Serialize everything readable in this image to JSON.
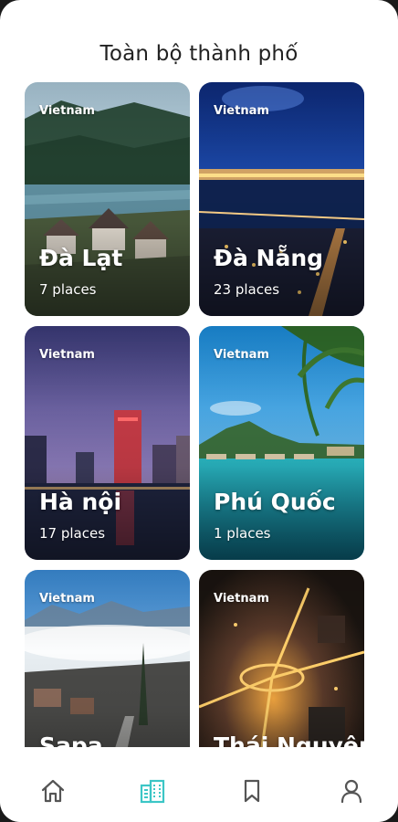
{
  "header": {
    "title": "Toàn bộ thành phố"
  },
  "cities": [
    {
      "country": "Vietnam",
      "name": "Đà Lạt",
      "places": "7 places",
      "image": "dalat-lake-villas"
    },
    {
      "country": "Vietnam",
      "name": "Đà Nẵng",
      "places": "23 places",
      "image": "danang-night-bridge"
    },
    {
      "country": "Vietnam",
      "name": "Hà nội",
      "places": "17 places",
      "image": "hanoi-skyline-dusk"
    },
    {
      "country": "Vietnam",
      "name": "Phú Quốc",
      "places": "1 places",
      "image": "phuquoc-beach-palm"
    },
    {
      "country": "Vietnam",
      "name": "Sapa",
      "places": "",
      "image": "sapa-misty-mountains"
    },
    {
      "country": "Vietnam",
      "name": "Thái Nguyên",
      "places": "",
      "image": "thainguyen-night-roundabout"
    }
  ],
  "bottom_nav": {
    "items": [
      {
        "icon": "home-icon",
        "active": false
      },
      {
        "icon": "city-buildings-icon",
        "active": true
      },
      {
        "icon": "bookmark-icon",
        "active": false
      },
      {
        "icon": "user-icon",
        "active": false
      }
    ],
    "active_color": "#3cc6c6",
    "inactive_color": "#555555"
  }
}
